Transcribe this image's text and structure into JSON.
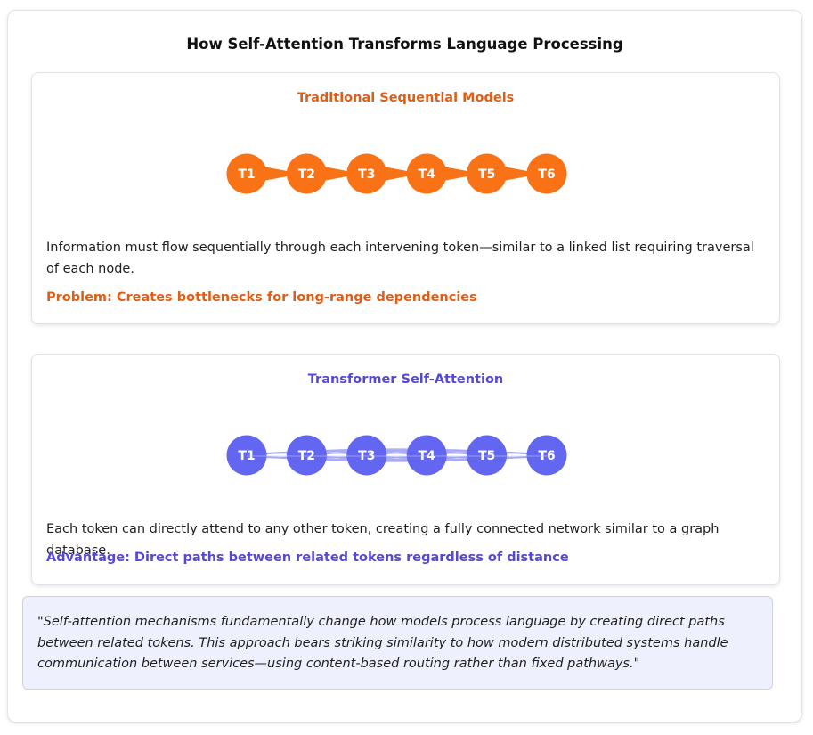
{
  "title": "How Self-Attention Transforms Language Processing",
  "sequential": {
    "title": "Traditional Sequential Models",
    "tokens": [
      "T1",
      "T2",
      "T3",
      "T4",
      "T5",
      "T6"
    ],
    "description": "Information must flow sequentially through each intervening token—similar to a linked list requiring traversal of each node.",
    "note": "Problem: Creates bottlenecks for long-range dependencies",
    "color": "#f97316"
  },
  "attention": {
    "title": "Transformer Self-Attention",
    "tokens": [
      "T1",
      "T2",
      "T3",
      "T4",
      "T5",
      "T6"
    ],
    "description": "Each token can directly attend to any other token, creating a fully connected network similar to a graph database.",
    "note": "Advantage: Direct paths between related tokens regardless of distance",
    "color": "#6366f1",
    "edge_color": "#a5a6f6"
  },
  "quote": "\"Self-attention mechanisms fundamentally change how models process language by creating direct paths between related tokens. This approach bears striking similarity to how modern distributed systems handle communication between services—using content-based routing rather than fixed pathways.\""
}
